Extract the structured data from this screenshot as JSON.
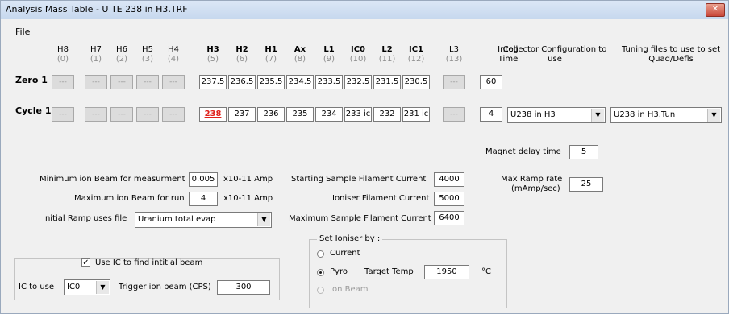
{
  "window": {
    "title": "Analysis Mass Table - U TE 238 in H3.TRF",
    "close": "✕"
  },
  "menu": {
    "file": "File"
  },
  "columns": [
    {
      "name": "H8",
      "num": "(0)",
      "bold": false
    },
    {
      "name": "H7",
      "num": "(1)",
      "bold": false
    },
    {
      "name": "H6",
      "num": "(2)",
      "bold": false
    },
    {
      "name": "H5",
      "num": "(3)",
      "bold": false
    },
    {
      "name": "H4",
      "num": "(4)",
      "bold": false
    },
    {
      "name": "H3",
      "num": "(5)",
      "bold": true
    },
    {
      "name": "H2",
      "num": "(6)",
      "bold": true
    },
    {
      "name": "H1",
      "num": "(7)",
      "bold": true
    },
    {
      "name": "Ax",
      "num": "(8)",
      "bold": true
    },
    {
      "name": "L1",
      "num": "(9)",
      "bold": true
    },
    {
      "name": "IC0",
      "num": "(10)",
      "bold": true
    },
    {
      "name": "L2",
      "num": "(11)",
      "bold": true
    },
    {
      "name": "IC1",
      "num": "(12)",
      "bold": true
    },
    {
      "name": "L3",
      "num": "(13)",
      "bold": false
    }
  ],
  "headers": {
    "integ_time": "Integ Time",
    "collector_config": "Collector Configuration to use",
    "tuning_files": "Tuning files to use to set Quad/Defls"
  },
  "zero": {
    "label": "Zero 1",
    "cells": [
      "---",
      "---",
      "---",
      "---",
      "---",
      "237.5",
      "236.5",
      "235.5",
      "234.5",
      "233.5",
      "232.5",
      "231.5",
      "230.5",
      "---"
    ],
    "integ": "60"
  },
  "cycle": {
    "label": "Cycle 1",
    "cells": [
      "---",
      "---",
      "---",
      "---",
      "---",
      "238",
      "237",
      "236",
      "235",
      "234",
      "233 ic",
      "232",
      "231 ic",
      "---"
    ],
    "integ": "4",
    "collector": "U238 in H3",
    "tuning": "U238 in H3.Tun"
  },
  "params": {
    "min_beam_label": "Minimum ion Beam for measurment",
    "min_beam_value": "0.005",
    "min_beam_unit": "x10-11 Amp",
    "max_beam_label": "Maximum ion Beam for run",
    "max_beam_value": "4",
    "max_beam_unit": "x10-11 Amp",
    "ramp_label": "Initial Ramp uses file",
    "ramp_value": "Uranium total evap",
    "start_fil_label": "Starting Sample Filament Current",
    "start_fil_value": "4000",
    "ioniser_fil_label": "Ioniser Filament Current",
    "ioniser_fil_value": "5000",
    "max_fil_label": "Maximum Sample Filament Current",
    "max_fil_value": "6400",
    "magnet_delay_label": "Magnet delay time",
    "magnet_delay_value": "5",
    "max_ramp_label": "Max Ramp rate",
    "max_ramp_unit": "(mAmp/sec)",
    "max_ramp_value": "25"
  },
  "ic": {
    "use_ic_label": "Use IC to find intitial beam",
    "use_ic_checked": "✓",
    "ic_to_use_label": "IC to use",
    "ic_to_use_value": "IC0",
    "trigger_label": "Trigger ion beam (CPS)",
    "trigger_value": "300"
  },
  "ioniser": {
    "legend": "Set Ioniser by :",
    "current": "Current",
    "pyro": "Pyro",
    "target_temp_label": "Target Temp",
    "target_temp_value": "1950",
    "temp_unit": "°C",
    "ion_beam": "Ion Beam"
  }
}
